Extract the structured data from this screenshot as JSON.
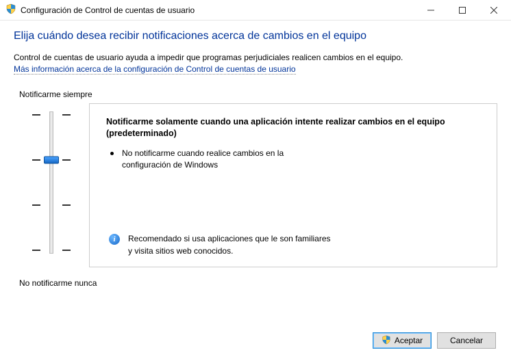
{
  "window": {
    "title": "Configuración de Control de cuentas de usuario"
  },
  "heading": "Elija cuándo desea recibir notificaciones acerca de cambios en el equipo",
  "description": "Control de cuentas de usuario ayuda a impedir que programas perjudiciales realicen cambios en el equipo.",
  "link": "Más información acerca de la configuración de Control de cuentas de usuario",
  "slider": {
    "top_label": "Notificarme siempre",
    "bottom_label": "No notificarme nunca",
    "levels": 4,
    "selected_index": 1
  },
  "panel": {
    "title": "Notificarme solamente cuando una aplicación intente realizar cambios en el equipo (predeterminado)",
    "bullet": "No notificarme cuando realice cambios en la configuración de Windows",
    "info": "Recomendado si usa aplicaciones que le son familiares y visita sitios web conocidos."
  },
  "buttons": {
    "ok": "Aceptar",
    "cancel": "Cancelar"
  },
  "icons": {
    "info_glyph": "i"
  }
}
